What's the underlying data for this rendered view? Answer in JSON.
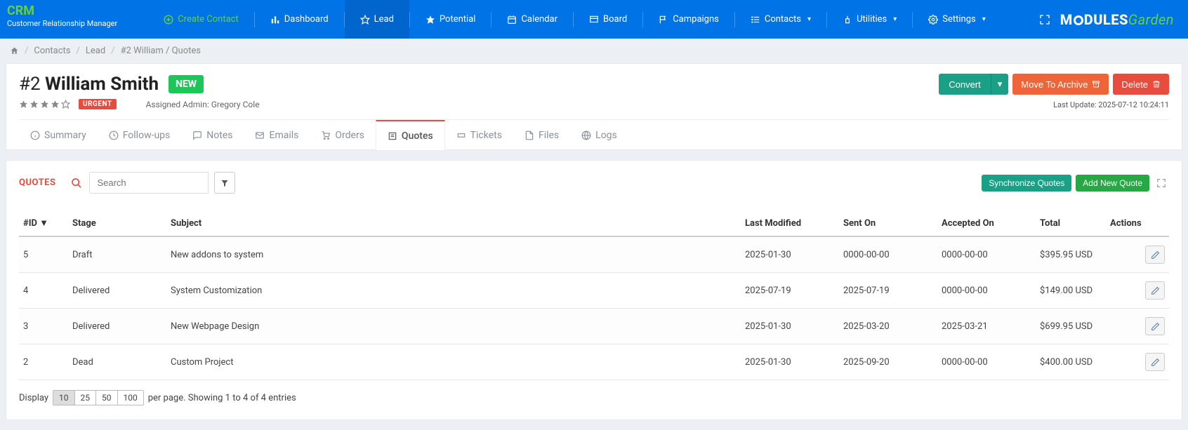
{
  "brand": {
    "title": "CRM",
    "subtitle": "Customer Relationship Manager"
  },
  "nav": {
    "create": "Create Contact",
    "dashboard": "Dashboard",
    "lead": "Lead",
    "potential": "Potential",
    "calendar": "Calendar",
    "board": "Board",
    "campaigns": "Campaigns",
    "contacts": "Contacts",
    "utilities": "Utilities",
    "settings": "Settings"
  },
  "logo": {
    "prefix": "M",
    "mid": "DULES",
    "suffix": "Garden"
  },
  "breadcrumb": {
    "contacts": "Contacts",
    "lead": "Lead",
    "current": "#2 William / Quotes"
  },
  "header": {
    "number": "#2",
    "name": "William Smith",
    "badge": "NEW",
    "urgent": "URGENT",
    "assigned_label": "Assigned Admin: Gregory Cole",
    "convert": "Convert",
    "archive": "Move To Archive",
    "delete": "Delete",
    "last_update": "Last Update: 2025-07-12 10:24:11"
  },
  "tabs": {
    "summary": "Summary",
    "followups": "Follow-ups",
    "notes": "Notes",
    "emails": "Emails",
    "orders": "Orders",
    "quotes": "Quotes",
    "tickets": "Tickets",
    "files": "Files",
    "logs": "Logs"
  },
  "panel": {
    "title": "QUOTES",
    "search_placeholder": "Search",
    "sync": "Synchronize Quotes",
    "add": "Add New Quote"
  },
  "table": {
    "headers": {
      "id": "#ID ▼",
      "stage": "Stage",
      "subject": "Subject",
      "modified": "Last Modified",
      "sent": "Sent On",
      "accepted": "Accepted On",
      "total": "Total",
      "actions": "Actions"
    },
    "rows": [
      {
        "id": "5",
        "stage": "Draft",
        "subject": "New addons to system",
        "modified": "2025-01-30",
        "sent": "0000-00-00",
        "accepted": "0000-00-00",
        "total": "$395.95 USD"
      },
      {
        "id": "4",
        "stage": "Delivered",
        "subject": "System Customization",
        "modified": "2025-07-19",
        "sent": "2025-07-19",
        "accepted": "0000-00-00",
        "total": "$149.00 USD"
      },
      {
        "id": "3",
        "stage": "Delivered",
        "subject": "New Webpage Design",
        "modified": "2025-01-30",
        "sent": "2025-03-20",
        "accepted": "2025-03-21",
        "total": "$699.95 USD"
      },
      {
        "id": "2",
        "stage": "Dead",
        "subject": "Custom Project",
        "modified": "2025-01-30",
        "sent": "2025-09-20",
        "accepted": "0000-00-00",
        "total": "$400.00 USD"
      }
    ]
  },
  "footer": {
    "display": "Display",
    "per_page": "per page. Showing 1 to 4 of 4 entries",
    "sizes": [
      "10",
      "25",
      "50",
      "100"
    ]
  }
}
